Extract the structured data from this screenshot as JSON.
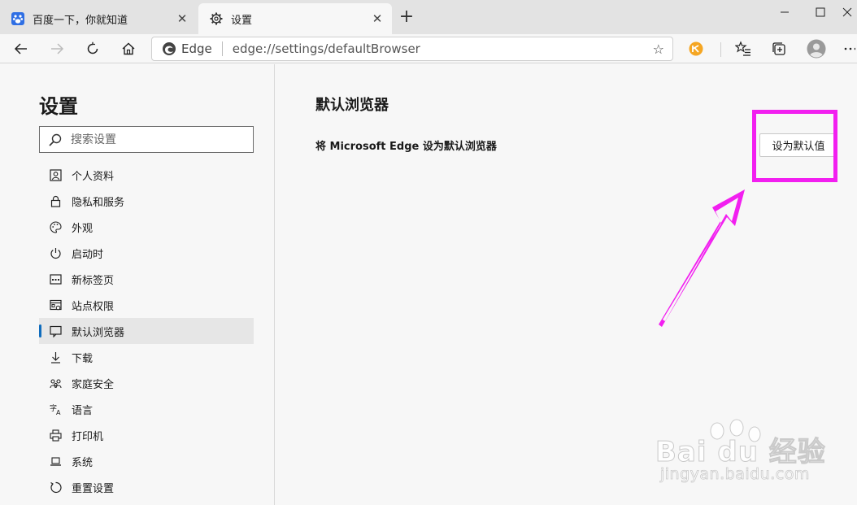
{
  "tabs": [
    {
      "title": "百度一下，你就知道",
      "icon": "baidu-paw-icon",
      "active": false
    },
    {
      "title": "设置",
      "icon": "gear-icon",
      "active": true
    }
  ],
  "toolbar": {
    "site_name": "Edge",
    "url": "edge://settings/defaultBrowser"
  },
  "sidebar": {
    "title": "设置",
    "search_placeholder": "搜索设置",
    "items": [
      {
        "label": "个人资料",
        "icon": "profile-icon"
      },
      {
        "label": "隐私和服务",
        "icon": "lock-icon"
      },
      {
        "label": "外观",
        "icon": "palette-icon"
      },
      {
        "label": "启动时",
        "icon": "power-icon"
      },
      {
        "label": "新标签页",
        "icon": "new-tab-icon"
      },
      {
        "label": "站点权限",
        "icon": "site-permissions-icon"
      },
      {
        "label": "默认浏览器",
        "icon": "default-browser-icon",
        "active": true
      },
      {
        "label": "下载",
        "icon": "download-icon"
      },
      {
        "label": "家庭安全",
        "icon": "family-icon"
      },
      {
        "label": "语言",
        "icon": "language-icon"
      },
      {
        "label": "打印机",
        "icon": "printer-icon"
      },
      {
        "label": "系统",
        "icon": "laptop-icon"
      },
      {
        "label": "重置设置",
        "icon": "reset-icon"
      }
    ]
  },
  "main": {
    "title": "默认浏览器",
    "setting_label": "将 Microsoft Edge 设为默认浏览器",
    "button_label": "设为默认值"
  },
  "watermark": {
    "brand": "Bai du 经验",
    "url": "jingyan.baidu.com"
  },
  "colors": {
    "accent": "#0f6cbd",
    "annotation": "#f21ff0"
  }
}
